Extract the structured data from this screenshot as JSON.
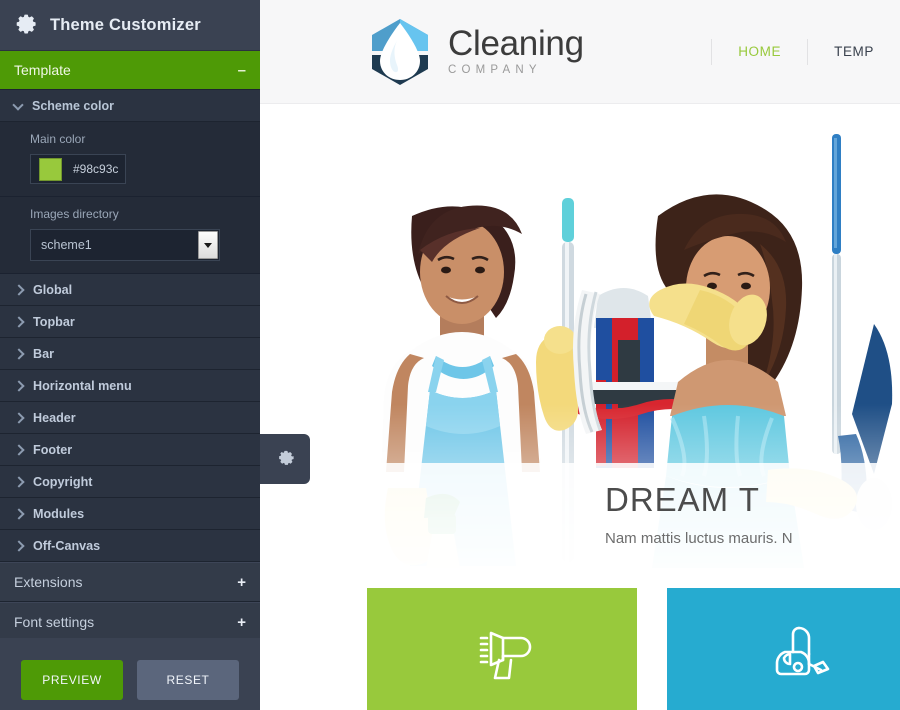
{
  "customizer": {
    "title": "Theme Customizer",
    "gear_icon": "gear-icon",
    "sections": [
      {
        "label": "Template",
        "sign": "–",
        "state": "expanded",
        "style": "green"
      },
      {
        "label": "Extensions",
        "sign": "+",
        "state": "collapsed",
        "style": "dark"
      },
      {
        "label": "Font settings",
        "sign": "+",
        "state": "collapsed",
        "style": "dark"
      }
    ],
    "scheme_color": {
      "label": "Scheme color",
      "chevron": "chevron-down-icon",
      "main_color": {
        "label": "Main color",
        "value": "#98c93c",
        "swatch": "#98c93c"
      },
      "images_directory": {
        "label": "Images directory",
        "value": "scheme1",
        "arrow_icon": "chevron-down-icon"
      }
    },
    "nav_items": [
      {
        "label": "Global",
        "chevron": "chevron-right-icon"
      },
      {
        "label": "Topbar",
        "chevron": "chevron-right-icon"
      },
      {
        "label": "Bar",
        "chevron": "chevron-right-icon"
      },
      {
        "label": "Horizontal menu",
        "chevron": "chevron-right-icon"
      },
      {
        "label": "Header",
        "chevron": "chevron-right-icon"
      },
      {
        "label": "Footer",
        "chevron": "chevron-right-icon"
      },
      {
        "label": "Copyright",
        "chevron": "chevron-right-icon"
      },
      {
        "label": "Modules",
        "chevron": "chevron-right-icon"
      },
      {
        "label": "Off-Canvas",
        "chevron": "chevron-right-icon"
      }
    ],
    "buttons": {
      "preview": "PREVIEW",
      "reset": "RESET"
    },
    "toggle_icon": "gear-icon",
    "colors": {
      "panel_bg": "#242b38",
      "panel_header_bg": "#3a4252",
      "accent_green": "#4e9a06",
      "row_bg": "#2b3341",
      "reset_btn": "#5b667c"
    }
  },
  "site": {
    "brand": {
      "name": "Cleaning",
      "tagline": "COMPANY",
      "logo_icon": "water-drop-hexagon-logo"
    },
    "nav": [
      {
        "label": "HOME",
        "active": true
      },
      {
        "label": "TEMP",
        "active": false
      }
    ],
    "hero": {
      "title": "DREAM T",
      "subtitle": "Nam mattis luctus mauris. N",
      "image_alt": "two-cleaning-women-with-mop-and-squeegee"
    },
    "cards": [
      {
        "icon": "blower-icon",
        "color": "#98c93c"
      },
      {
        "icon": "vacuum-cleaner-icon",
        "color": "#26abd0"
      }
    ]
  }
}
